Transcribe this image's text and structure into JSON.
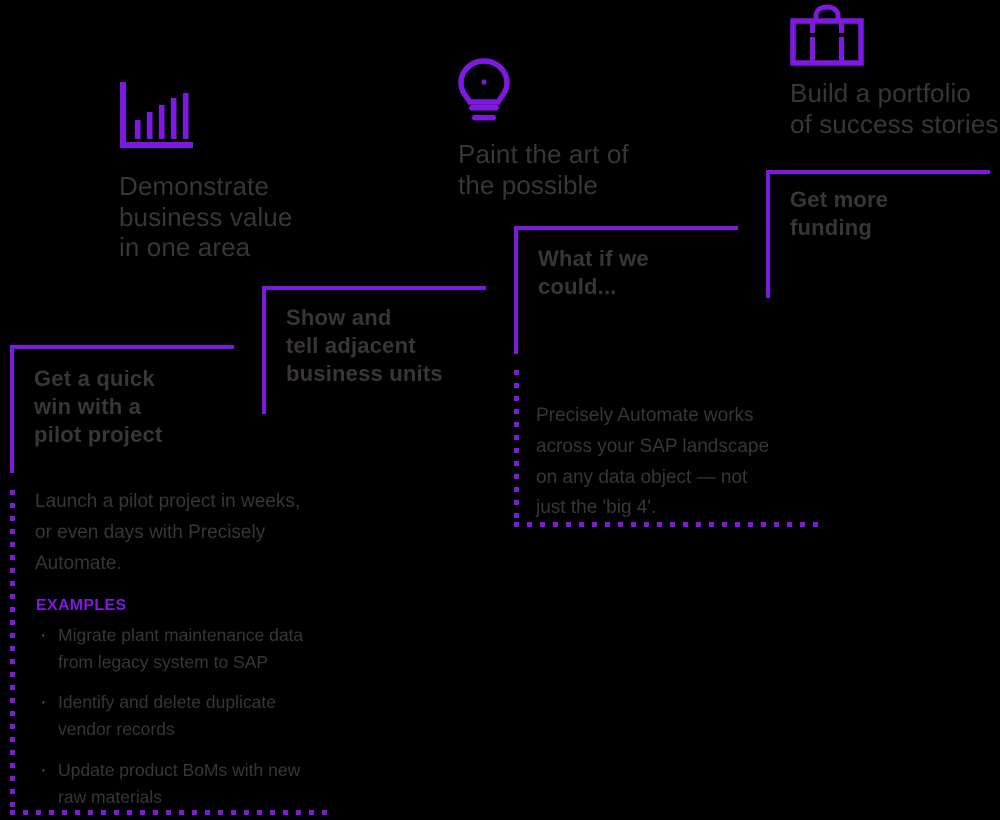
{
  "theme": {
    "background": "#000000",
    "accent_purple": "#7d19e0",
    "text_grey": "#3a3536"
  },
  "steps": [
    {
      "id": "pilot-project",
      "icon": "bar-chart-icon",
      "outcome_heading": "Demonstrate\nbusiness value\nin one area",
      "action_heading": "Get a quick\nwin with a\npilot project",
      "detail_paragraph": "Launch a pilot project in weeks,\nor even days with Precisely\nAutomate.",
      "examples_label": "EXAMPLES",
      "examples": [
        "Migrate plant maintenance data\nfrom legacy system to SAP",
        "Identify and delete duplicate\nvendor records",
        "Update product BoMs with new\nraw materials"
      ]
    },
    {
      "id": "adjacent-business-units",
      "icon": null,
      "outcome_heading": null,
      "action_heading": "Show and\ntell adjacent\nbusiness units",
      "detail_paragraph": null
    },
    {
      "id": "what-if-we-could",
      "icon": "lightbulb-icon",
      "outcome_heading": "Paint the art of\nthe possible",
      "action_heading": "What if we\ncould...",
      "detail_paragraph": "Precisely Automate works\nacross your SAP landscape\non any data object — not\njust the 'big 4'."
    },
    {
      "id": "get-more-funding",
      "icon": "briefcase-icon",
      "outcome_heading": "Build a portfolio\nof success stories",
      "action_heading": "Get more\nfunding",
      "detail_paragraph": null
    }
  ]
}
